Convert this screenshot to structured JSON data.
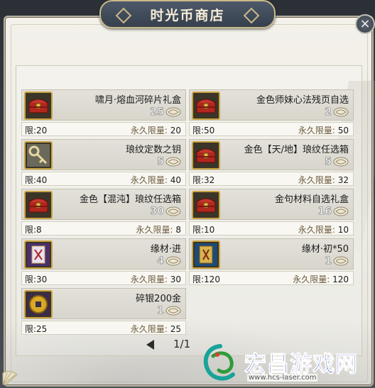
{
  "title": "时光币商店",
  "close_label": "×",
  "items": [
    {
      "name": "啸月·熔血河碎片礼盒",
      "price": "25",
      "limit": "限:20",
      "perm_label": "永久限量:",
      "perm_value": "20",
      "icon": "red-chest-icon"
    },
    {
      "name": "金色师妹心法残页自选",
      "price": "2",
      "limit": "限:50",
      "perm_label": "永久限量:",
      "perm_value": "50",
      "icon": "red-chest-icon"
    },
    {
      "name": "琅纹定数之钥",
      "price": "5",
      "limit": "限:40",
      "perm_label": "永久限量:",
      "perm_value": "40",
      "icon": "key-icon"
    },
    {
      "name": "金色【天/地】琅纹任选箱",
      "price": "5",
      "limit": "限:32",
      "perm_label": "永久限量:",
      "perm_value": "32",
      "icon": "red-chest-icon"
    },
    {
      "name": "金色【混沌】琅纹任选箱",
      "price": "30",
      "limit": "限:8",
      "perm_label": "永久限量:",
      "perm_value": "8",
      "icon": "red-chest-icon"
    },
    {
      "name": "金句材料自选礼盒",
      "price": "16",
      "limit": "限:10",
      "perm_label": "永久限量:",
      "perm_value": "10",
      "icon": "red-chest-icon"
    },
    {
      "name": "缘材·进",
      "price": "4",
      "limit": "限:30",
      "perm_label": "永久限量:",
      "perm_value": "30",
      "icon": "purple-scroll-icon"
    },
    {
      "name": "缘材·初*50",
      "price": "1",
      "limit": "限:120",
      "perm_label": "永久限量:",
      "perm_value": "120",
      "icon": "blue-scroll-icon"
    },
    {
      "name": "碎银200金",
      "price": "1",
      "limit": "限:25",
      "perm_label": "永久限量:",
      "perm_value": "25",
      "icon": "gold-coin-icon"
    }
  ],
  "pagination": {
    "text": "1/1",
    "prev_icon": "prev-arrow-icon"
  },
  "watermark": {
    "text": "宏昌游戏网",
    "url": "www.hcs-laser.com"
  },
  "colors": {
    "title_bg": "#3f4a58",
    "gold_border": "#c9a340",
    "chest_red": "#b2261e",
    "watermark_blue": "#1d3fb8"
  }
}
